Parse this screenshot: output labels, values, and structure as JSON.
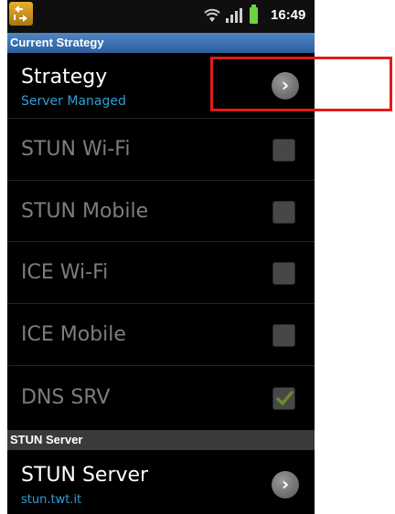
{
  "status_bar": {
    "time": "16:49",
    "icons": [
      "download-notification-icon",
      "wifi-icon",
      "signal-icon",
      "battery-icon"
    ]
  },
  "sections": {
    "current_strategy": "Current Strategy",
    "stun_server": "STUN Server"
  },
  "rows": {
    "strategy": {
      "title": "Strategy",
      "summary": "Server Managed"
    },
    "stun_wifi": {
      "title": "STUN Wi-Fi",
      "checked": false,
      "enabled": false
    },
    "stun_mobile": {
      "title": "STUN Mobile",
      "checked": false,
      "enabled": false
    },
    "ice_wifi": {
      "title": "ICE Wi-Fi",
      "checked": false,
      "enabled": false
    },
    "ice_mobile": {
      "title": "ICE Mobile",
      "checked": false,
      "enabled": false
    },
    "dns_srv": {
      "title": "DNS SRV",
      "checked": true,
      "enabled": false
    },
    "stun_server": {
      "title": "STUN Server",
      "summary": "stun.twt.it"
    }
  },
  "colors": {
    "header_accent": "#3f76b6",
    "summary_text": "#2f9fd6",
    "highlight": "#e21a1a",
    "checkmark": "#6a8a2c"
  }
}
